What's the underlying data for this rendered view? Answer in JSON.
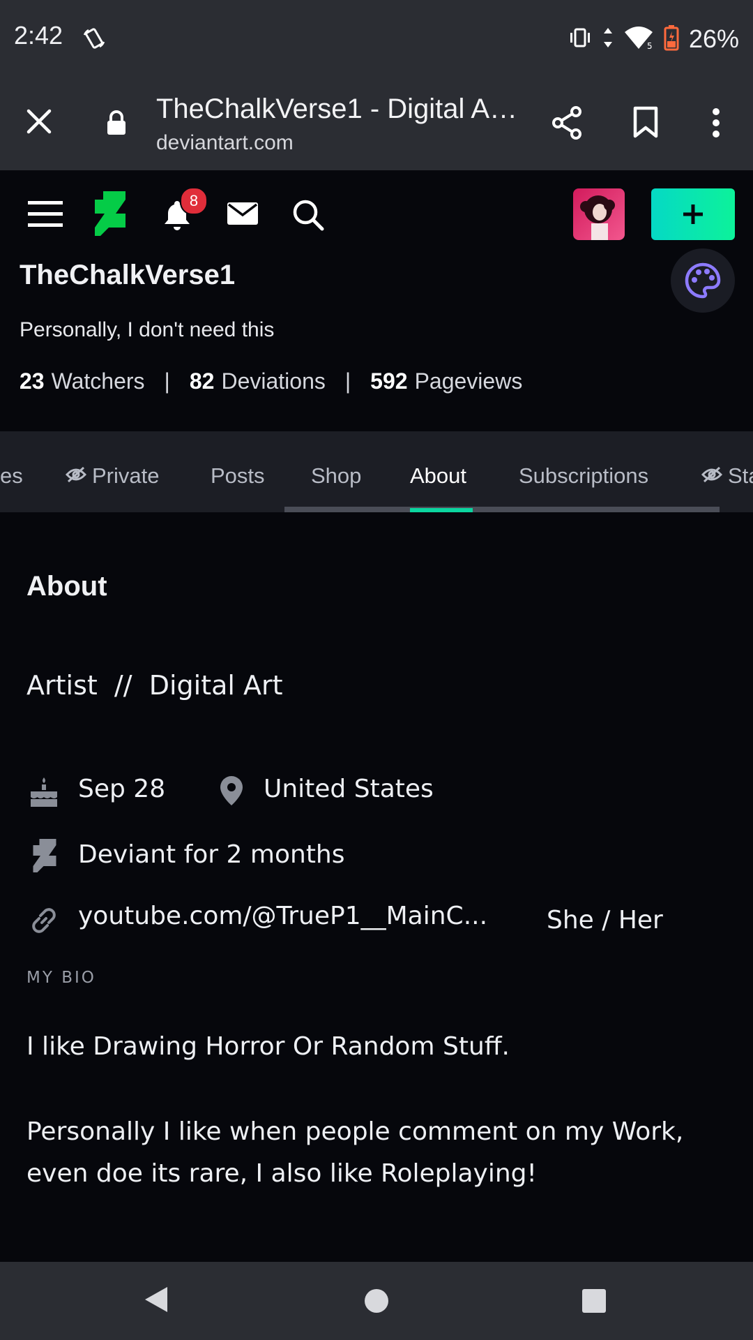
{
  "status_bar": {
    "time": "2:42",
    "battery": "26%"
  },
  "browser": {
    "title": "TheChalkVerse1 - Digital Ar...",
    "domain": "deviantart.com"
  },
  "site_nav": {
    "notification_count": "8"
  },
  "profile": {
    "username": "TheChalkVerse1",
    "tagline": "Personally, I don't need this",
    "stats": [
      {
        "value": "23",
        "label": "Watchers"
      },
      {
        "value": "82",
        "label": "Deviations"
      },
      {
        "value": "592",
        "label": "Pageviews"
      }
    ],
    "separator": "|"
  },
  "tabs": [
    "es",
    "Private",
    "Posts",
    "Shop",
    "About",
    "Subscriptions",
    "Sta"
  ],
  "active_tab": "About",
  "about": {
    "heading": "About",
    "headline": "Artist  //  Digital Art",
    "birthday": "Sep 28",
    "location": "United States",
    "membership": "Deviant for 2 months",
    "link": "youtube.com/@TrueP1__MainC...",
    "pronouns": "She / Her",
    "bio_label": "MY BIO",
    "bio_paragraphs": [
      "I like Drawing Horror Or Random Stuff.",
      "Personally I like when people comment on my Work, even doe its rare, I also like Roleplaying!"
    ]
  },
  "colors": {
    "accent": "#0bd6a0",
    "badge": "#e02d3a",
    "brand": "#05cc47"
  }
}
